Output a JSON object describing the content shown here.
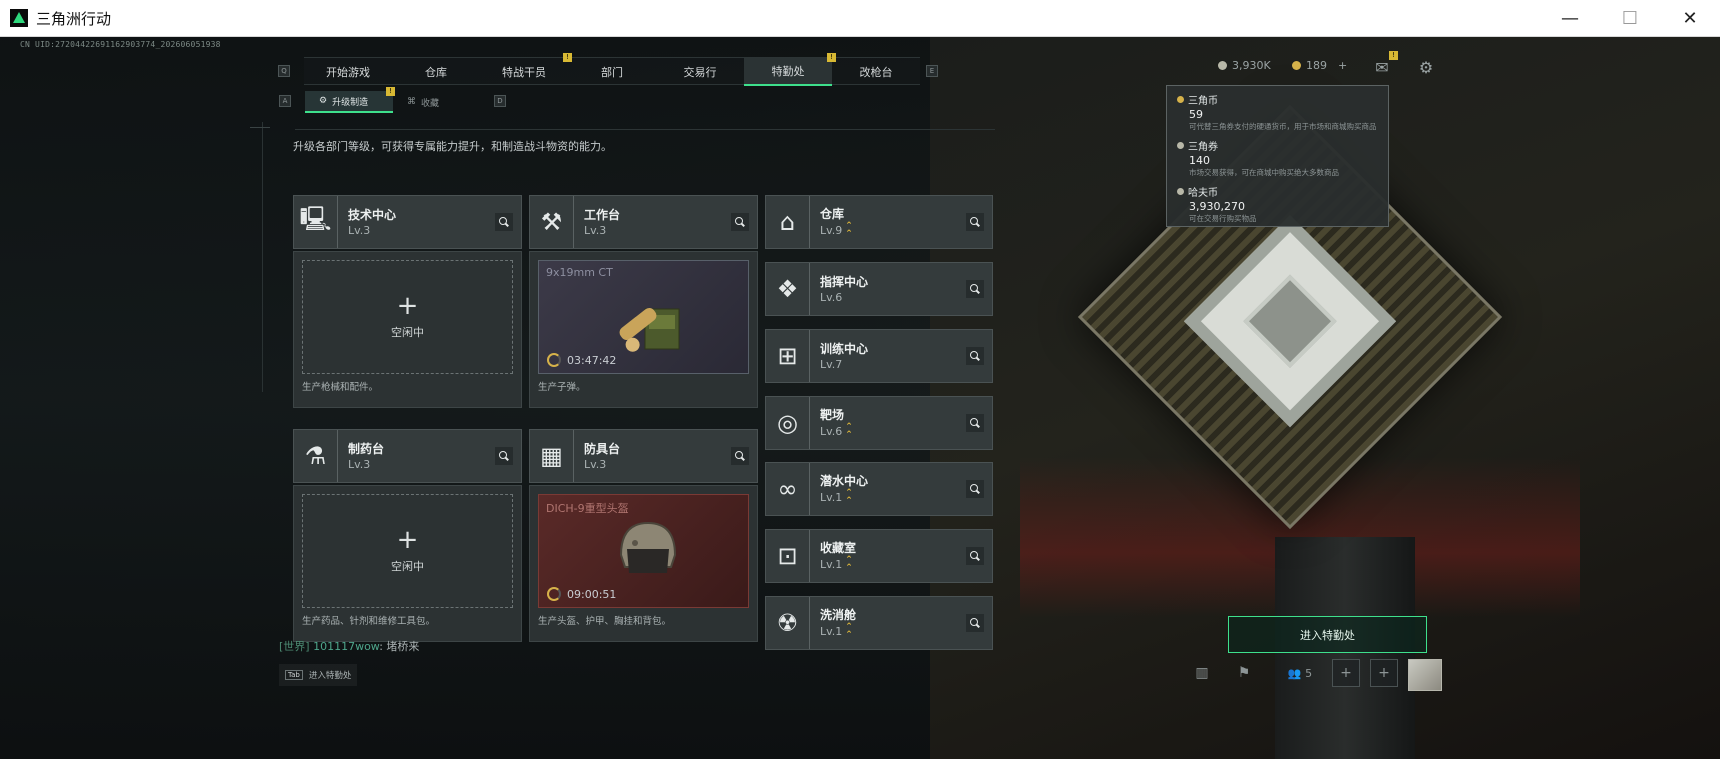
{
  "window": {
    "title": "三角洲行动",
    "minimize": "—",
    "maximize": "☐",
    "close": "✕"
  },
  "uid": "CN UID:27204422691162903774_202606051938",
  "nav": {
    "left_key": "Q",
    "right_key": "E",
    "tabs": [
      {
        "label": "开始游戏",
        "badge": ""
      },
      {
        "label": "仓库",
        "badge": ""
      },
      {
        "label": "特战干员",
        "badge": "!"
      },
      {
        "label": "部门",
        "badge": ""
      },
      {
        "label": "交易行",
        "badge": ""
      },
      {
        "label": "特勤处",
        "badge": "!"
      },
      {
        "label": "改枪台",
        "badge": ""
      }
    ]
  },
  "subnav": {
    "left_key": "A",
    "right_key": "D",
    "tabs": [
      {
        "label": "升级制造",
        "badge": "!"
      },
      {
        "label": "收藏",
        "badge": ""
      }
    ]
  },
  "currency": {
    "hafu": "3,930K",
    "coupon": "189",
    "plus": "+",
    "mail_badge": "!"
  },
  "popup": {
    "items": [
      {
        "name": "三角币",
        "value": "59",
        "desc": "可代替三角券支付的硬通货币，用于市场和商城购买商品"
      },
      {
        "name": "三角券",
        "value": "140",
        "desc": "市场交易获得，可在商城中购买绝大多数商品"
      },
      {
        "name": "哈夫币",
        "value": "3,930,270",
        "desc": "可在交易行购买物品"
      }
    ]
  },
  "intro": "升级各部门等级，可获得专属能力提升，和制造战斗物资的能力。",
  "cards": {
    "tech": {
      "name": "技术中心",
      "level": "Lv.3",
      "slot": "空闲中",
      "plus": "+",
      "foot": "生产枪械和配件。"
    },
    "workbench": {
      "name": "工作台",
      "level": "Lv.3",
      "product": "9x19mm CT",
      "timer": "03:47:42",
      "foot": "生产子弹。"
    },
    "pharma": {
      "name": "制药台",
      "level": "Lv.3",
      "slot": "空闲中",
      "plus": "+",
      "foot": "生产药品、针剂和维修工具包。"
    },
    "armor": {
      "name": "防具台",
      "level": "Lv.3",
      "product": "DICH-9重型头盔",
      "timer": "09:00:51",
      "foot": "生产头盔、护甲、胸挂和背包。"
    }
  },
  "facilities": [
    {
      "name": "仓库",
      "level": "Lv.9",
      "upgrade": true
    },
    {
      "name": "指挥中心",
      "level": "Lv.6",
      "upgrade": false
    },
    {
      "name": "训练中心",
      "level": "Lv.7",
      "upgrade": false
    },
    {
      "name": "靶场",
      "level": "Lv.6",
      "upgrade": true
    },
    {
      "name": "潜水中心",
      "level": "Lv.1",
      "upgrade": true
    },
    {
      "name": "收藏室",
      "level": "Lv.1",
      "upgrade": true
    },
    {
      "name": "洗消舱",
      "level": "Lv.1",
      "upgrade": true
    }
  ],
  "enter_button": "进入特勤处",
  "chat": {
    "channel": "[世界]",
    "user": "101117wow",
    "message": "堵桥来"
  },
  "tab_hint": {
    "key": "Tab",
    "label": "进入特勤处"
  },
  "friends_count": "5"
}
